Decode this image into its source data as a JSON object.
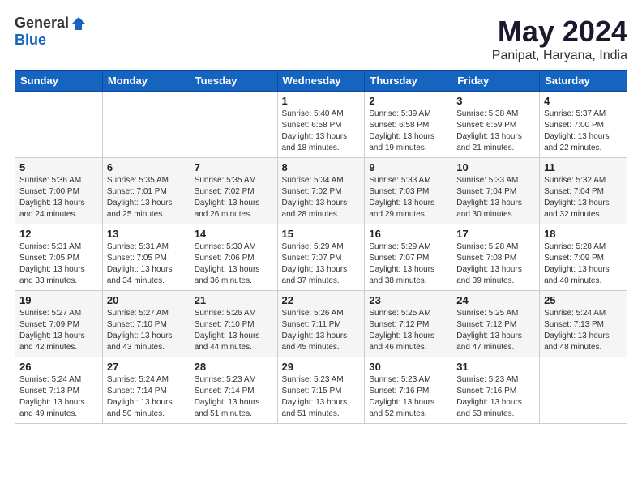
{
  "header": {
    "logo_general": "General",
    "logo_blue": "Blue",
    "title": "May 2024",
    "subtitle": "Panipat, Haryana, India"
  },
  "weekdays": [
    "Sunday",
    "Monday",
    "Tuesday",
    "Wednesday",
    "Thursday",
    "Friday",
    "Saturday"
  ],
  "weeks": [
    [
      {
        "day": "",
        "info": ""
      },
      {
        "day": "",
        "info": ""
      },
      {
        "day": "",
        "info": ""
      },
      {
        "day": "1",
        "info": "Sunrise: 5:40 AM\nSunset: 6:58 PM\nDaylight: 13 hours\nand 18 minutes."
      },
      {
        "day": "2",
        "info": "Sunrise: 5:39 AM\nSunset: 6:58 PM\nDaylight: 13 hours\nand 19 minutes."
      },
      {
        "day": "3",
        "info": "Sunrise: 5:38 AM\nSunset: 6:59 PM\nDaylight: 13 hours\nand 21 minutes."
      },
      {
        "day": "4",
        "info": "Sunrise: 5:37 AM\nSunset: 7:00 PM\nDaylight: 13 hours\nand 22 minutes."
      }
    ],
    [
      {
        "day": "5",
        "info": "Sunrise: 5:36 AM\nSunset: 7:00 PM\nDaylight: 13 hours\nand 24 minutes."
      },
      {
        "day": "6",
        "info": "Sunrise: 5:35 AM\nSunset: 7:01 PM\nDaylight: 13 hours\nand 25 minutes."
      },
      {
        "day": "7",
        "info": "Sunrise: 5:35 AM\nSunset: 7:02 PM\nDaylight: 13 hours\nand 26 minutes."
      },
      {
        "day": "8",
        "info": "Sunrise: 5:34 AM\nSunset: 7:02 PM\nDaylight: 13 hours\nand 28 minutes."
      },
      {
        "day": "9",
        "info": "Sunrise: 5:33 AM\nSunset: 7:03 PM\nDaylight: 13 hours\nand 29 minutes."
      },
      {
        "day": "10",
        "info": "Sunrise: 5:33 AM\nSunset: 7:04 PM\nDaylight: 13 hours\nand 30 minutes."
      },
      {
        "day": "11",
        "info": "Sunrise: 5:32 AM\nSunset: 7:04 PM\nDaylight: 13 hours\nand 32 minutes."
      }
    ],
    [
      {
        "day": "12",
        "info": "Sunrise: 5:31 AM\nSunset: 7:05 PM\nDaylight: 13 hours\nand 33 minutes."
      },
      {
        "day": "13",
        "info": "Sunrise: 5:31 AM\nSunset: 7:05 PM\nDaylight: 13 hours\nand 34 minutes."
      },
      {
        "day": "14",
        "info": "Sunrise: 5:30 AM\nSunset: 7:06 PM\nDaylight: 13 hours\nand 36 minutes."
      },
      {
        "day": "15",
        "info": "Sunrise: 5:29 AM\nSunset: 7:07 PM\nDaylight: 13 hours\nand 37 minutes."
      },
      {
        "day": "16",
        "info": "Sunrise: 5:29 AM\nSunset: 7:07 PM\nDaylight: 13 hours\nand 38 minutes."
      },
      {
        "day": "17",
        "info": "Sunrise: 5:28 AM\nSunset: 7:08 PM\nDaylight: 13 hours\nand 39 minutes."
      },
      {
        "day": "18",
        "info": "Sunrise: 5:28 AM\nSunset: 7:09 PM\nDaylight: 13 hours\nand 40 minutes."
      }
    ],
    [
      {
        "day": "19",
        "info": "Sunrise: 5:27 AM\nSunset: 7:09 PM\nDaylight: 13 hours\nand 42 minutes."
      },
      {
        "day": "20",
        "info": "Sunrise: 5:27 AM\nSunset: 7:10 PM\nDaylight: 13 hours\nand 43 minutes."
      },
      {
        "day": "21",
        "info": "Sunrise: 5:26 AM\nSunset: 7:10 PM\nDaylight: 13 hours\nand 44 minutes."
      },
      {
        "day": "22",
        "info": "Sunrise: 5:26 AM\nSunset: 7:11 PM\nDaylight: 13 hours\nand 45 minutes."
      },
      {
        "day": "23",
        "info": "Sunrise: 5:25 AM\nSunset: 7:12 PM\nDaylight: 13 hours\nand 46 minutes."
      },
      {
        "day": "24",
        "info": "Sunrise: 5:25 AM\nSunset: 7:12 PM\nDaylight: 13 hours\nand 47 minutes."
      },
      {
        "day": "25",
        "info": "Sunrise: 5:24 AM\nSunset: 7:13 PM\nDaylight: 13 hours\nand 48 minutes."
      }
    ],
    [
      {
        "day": "26",
        "info": "Sunrise: 5:24 AM\nSunset: 7:13 PM\nDaylight: 13 hours\nand 49 minutes."
      },
      {
        "day": "27",
        "info": "Sunrise: 5:24 AM\nSunset: 7:14 PM\nDaylight: 13 hours\nand 50 minutes."
      },
      {
        "day": "28",
        "info": "Sunrise: 5:23 AM\nSunset: 7:14 PM\nDaylight: 13 hours\nand 51 minutes."
      },
      {
        "day": "29",
        "info": "Sunrise: 5:23 AM\nSunset: 7:15 PM\nDaylight: 13 hours\nand 51 minutes."
      },
      {
        "day": "30",
        "info": "Sunrise: 5:23 AM\nSunset: 7:16 PM\nDaylight: 13 hours\nand 52 minutes."
      },
      {
        "day": "31",
        "info": "Sunrise: 5:23 AM\nSunset: 7:16 PM\nDaylight: 13 hours\nand 53 minutes."
      },
      {
        "day": "",
        "info": ""
      }
    ]
  ]
}
